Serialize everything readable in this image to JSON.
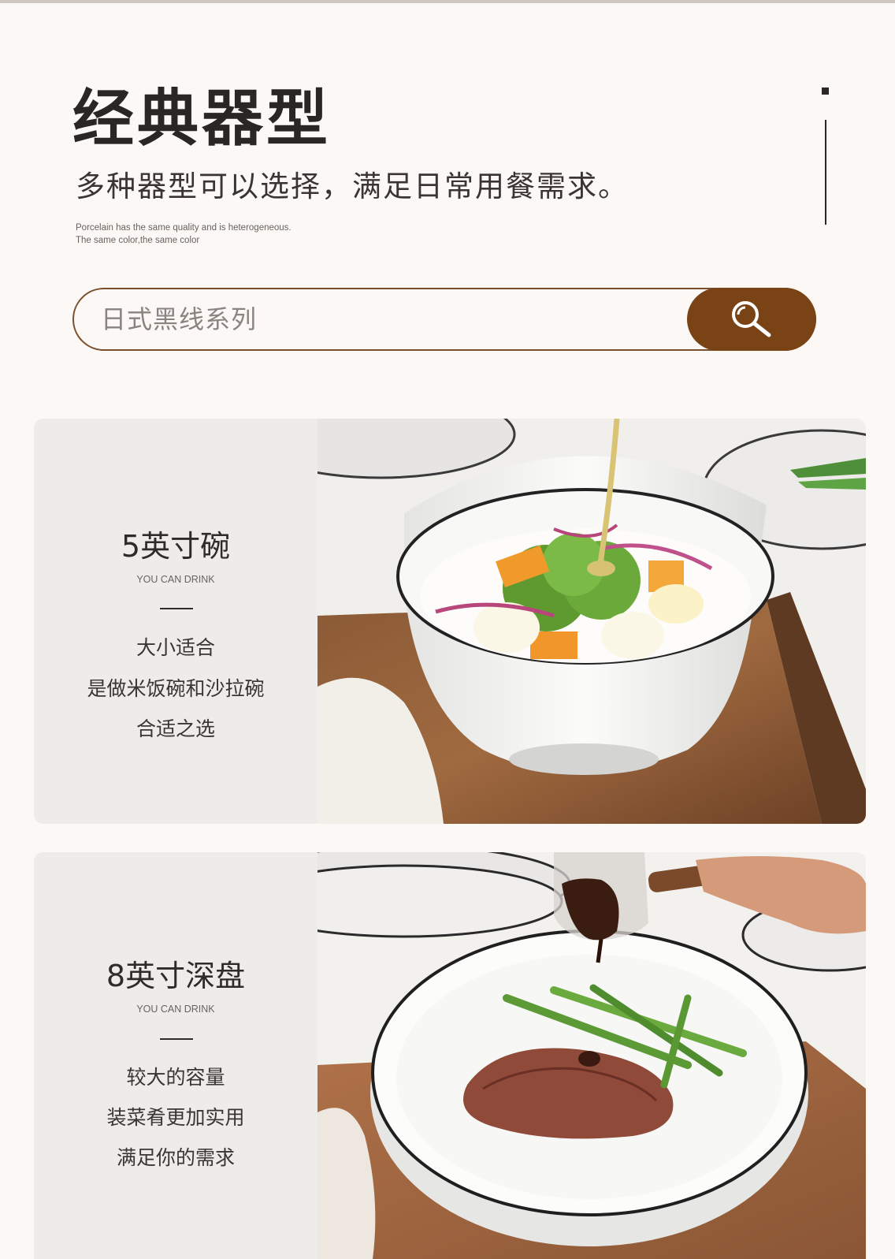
{
  "header": {
    "title": "经典器型",
    "subtitle": "多种器型可以选择，满足日常用餐需求。",
    "english_lines": [
      "Porcelain has the same quality and is heterogeneous.",
      "The same color,the same color"
    ]
  },
  "search": {
    "text": "日式黑线系列",
    "button_icon": "search-icon"
  },
  "products": [
    {
      "name": "5英寸碗",
      "english": "YOU CAN DRINK",
      "lines": [
        "大小适合",
        "是做米饭碗和沙拉碗",
        "合适之选"
      ]
    },
    {
      "name": "8英寸深盘",
      "english": "YOU CAN DRINK",
      "lines": [
        "较大的容量",
        "装菜肴更加实用",
        "满足你的需求"
      ]
    }
  ],
  "colors": {
    "accent_brown": "#7a4316",
    "border_brown": "#7a4e2a",
    "panel_gray": "#eeecea",
    "page_bg": "#fbf8f6"
  }
}
